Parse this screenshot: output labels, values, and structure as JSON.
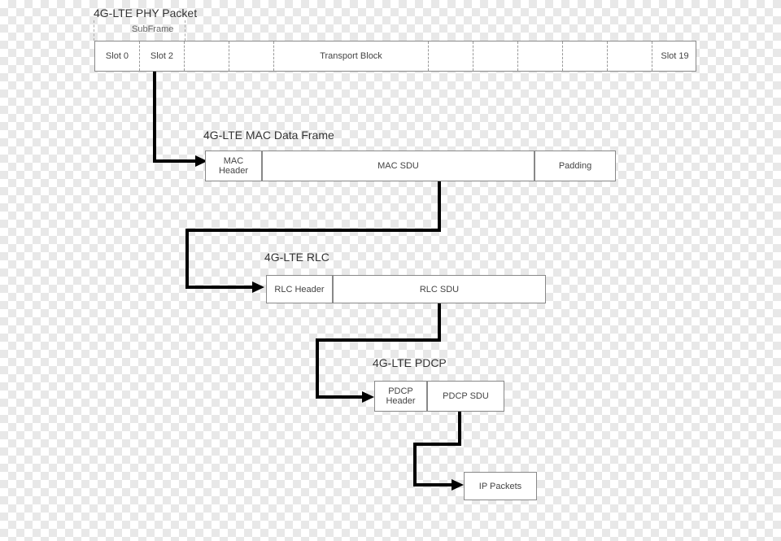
{
  "phy": {
    "title": "4G-LTE PHY  Packet",
    "subframe_label": "SubFrame",
    "slot0": "Slot 0",
    "slot2": "Slot 2",
    "transport_block": "Transport Block",
    "slot19": "Slot 19"
  },
  "mac": {
    "title": "4G-LTE MAC Data Frame",
    "header": "MAC\nHeader",
    "sdu": "MAC SDU",
    "padding": "Padding"
  },
  "rlc": {
    "title": "4G-LTE RLC",
    "header": "RLC Header",
    "sdu": "RLC SDU"
  },
  "pdcp": {
    "title": "4G-LTE PDCP",
    "header": "PDCP\nHeader",
    "sdu": "PDCP SDU"
  },
  "ip": {
    "label": "IP Packets"
  }
}
